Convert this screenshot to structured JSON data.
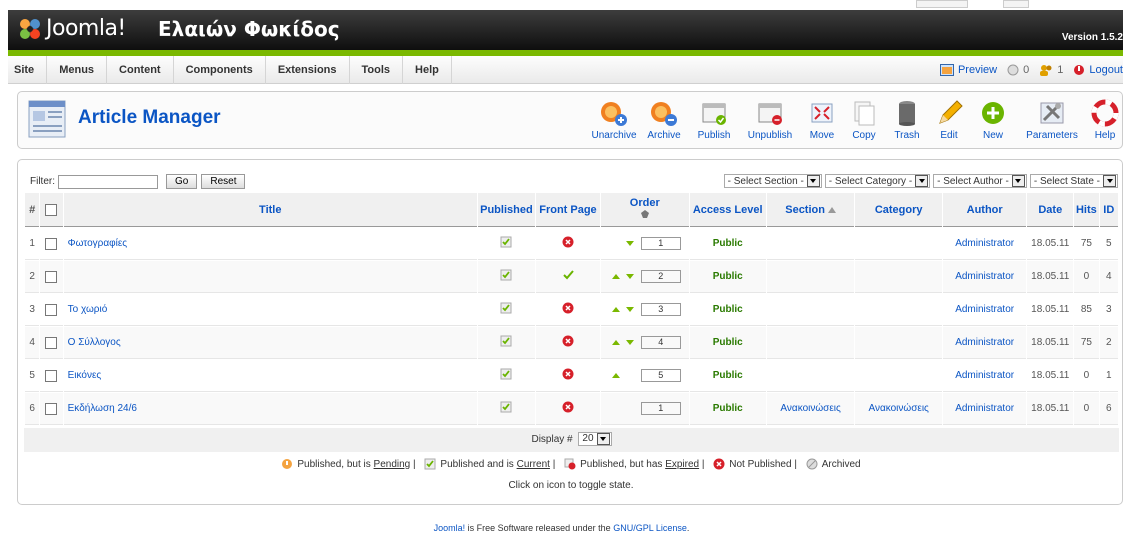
{
  "header": {
    "logo_text": "Joomla!",
    "site_name": "Ελαιών Φωκίδος",
    "version": "Version 1.5.2"
  },
  "menu": [
    "Site",
    "Menus",
    "Content",
    "Components",
    "Extensions",
    "Tools",
    "Help"
  ],
  "status": {
    "preview": "Preview",
    "messages": "0",
    "users": "1",
    "logout": "Logout"
  },
  "toolbar": {
    "title": "Article Manager",
    "buttons": [
      "Unarchive",
      "Archive",
      "Publish",
      "Unpublish",
      "Move",
      "Copy",
      "Trash",
      "Edit",
      "New",
      "Parameters",
      "Help"
    ]
  },
  "filter": {
    "label": "Filter:",
    "value": "",
    "go": "Go",
    "reset": "Reset",
    "selects": [
      "- Select Section -",
      "- Select Category -",
      "- Select Author -",
      "- Select State -"
    ]
  },
  "table": {
    "headers": {
      "num": "#",
      "title": "Title",
      "published": "Published",
      "frontpage": "Front Page",
      "order": "Order",
      "access": "Access Level",
      "section": "Section",
      "category": "Category",
      "author": "Author",
      "date": "Date",
      "hits": "Hits",
      "id": "ID"
    },
    "rows": [
      {
        "num": "1",
        "title": "Φωτογραφίες",
        "front": "no",
        "up": false,
        "down": true,
        "order": "1",
        "access": "Public",
        "section": "",
        "category": "",
        "author": "Administrator",
        "date": "18.05.11",
        "hits": "75",
        "id": "5"
      },
      {
        "num": "2",
        "title": "",
        "front": "yes",
        "up": true,
        "down": true,
        "order": "2",
        "access": "Public",
        "section": "",
        "category": "",
        "author": "Administrator",
        "date": "18.05.11",
        "hits": "0",
        "id": "4"
      },
      {
        "num": "3",
        "title": "Το χωριό",
        "front": "no",
        "up": true,
        "down": true,
        "order": "3",
        "access": "Public",
        "section": "",
        "category": "",
        "author": "Administrator",
        "date": "18.05.11",
        "hits": "85",
        "id": "3"
      },
      {
        "num": "4",
        "title": "Ο Σύλλογος",
        "front": "no",
        "up": true,
        "down": true,
        "order": "4",
        "access": "Public",
        "section": "",
        "category": "",
        "author": "Administrator",
        "date": "18.05.11",
        "hits": "75",
        "id": "2"
      },
      {
        "num": "5",
        "title": "Εικόνες",
        "front": "no",
        "up": true,
        "down": false,
        "order": "5",
        "access": "Public",
        "section": "",
        "category": "",
        "author": "Administrator",
        "date": "18.05.11",
        "hits": "0",
        "id": "1"
      },
      {
        "num": "6",
        "title": "Εκδήλωση 24/6",
        "front": "no",
        "up": false,
        "down": false,
        "order": "1",
        "access": "Public",
        "section": "Ανακοινώσεις",
        "category": "Ανακοινώσεις",
        "author": "Administrator",
        "date": "18.05.11",
        "hits": "0",
        "id": "6"
      }
    ]
  },
  "pagination": {
    "display_label": "Display #",
    "display_value": "20"
  },
  "legend": {
    "pending_prefix": "Published, but is",
    "pending_link": "Pending",
    "current_prefix": "Published and is",
    "current_link": "Current",
    "expired_prefix": "Published, but has",
    "expired_link": "Expired",
    "not_published": "Not Published",
    "archived": "Archived",
    "sep": "|",
    "toggle": "Click on icon to toggle state."
  },
  "footer": {
    "prefix": "Joomla!",
    "middle": "is Free Software released under the",
    "license": "GNU/GPL License",
    "suffix": "."
  },
  "colors": {
    "accent_blue": "#0b55c4",
    "header_green": "#7ab800",
    "published_green": "#2a7a00",
    "unpublished_red": "#d6202a"
  }
}
